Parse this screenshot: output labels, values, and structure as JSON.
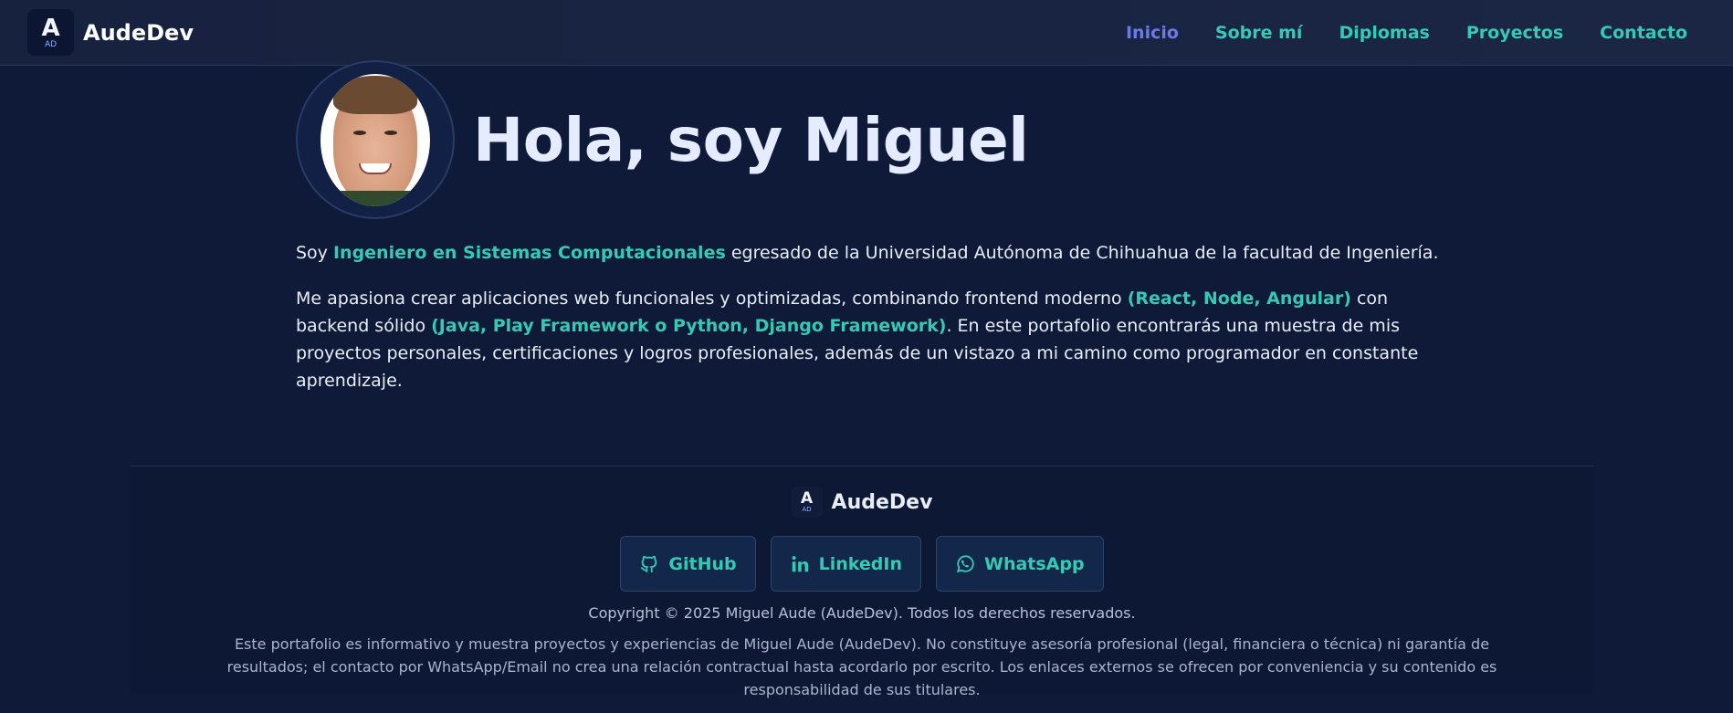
{
  "navbar": {
    "logo": {
      "letter": "A",
      "sub": "AD"
    },
    "brand": "AudeDev",
    "links": [
      {
        "label": "Inicio",
        "active": true
      },
      {
        "label": "Sobre mí",
        "active": false
      },
      {
        "label": "Diplomas",
        "active": false
      },
      {
        "label": "Proyectos",
        "active": false
      },
      {
        "label": "Contacto",
        "active": false
      }
    ]
  },
  "hero": {
    "title": "Hola, soy Miguel",
    "p1": {
      "before": "Soy ",
      "highlight": "Ingeniero en Sistemas Computacionales",
      "after": " egresado de la Universidad Autónoma de Chihuahua de la facultad de Ingeniería."
    },
    "p2": {
      "part1": "Me apasiona crear aplicaciones web funcionales y optimizadas, combinando frontend moderno ",
      "highlight1": "(React, Node, Angular)",
      "part2": " con backend sólido ",
      "highlight2": "(Java, Play Framework o Python, Django Framework)",
      "part3": ". En este portafolio encontrarás una muestra de mis proyectos personales, certificaciones y logros profesionales, además de un vistazo a mi camino como programador en constante aprendizaje."
    }
  },
  "footer": {
    "logo": {
      "letter": "A",
      "sub": "AD"
    },
    "brand": "AudeDev",
    "socials": [
      {
        "label": "GitHub",
        "icon": "github-icon"
      },
      {
        "label": "LinkedIn",
        "icon": "linkedin-icon"
      },
      {
        "label": "WhatsApp",
        "icon": "whatsapp-icon"
      }
    ],
    "copyright": "Copyright © 2025 Miguel Aude (AudeDev). Todos los derechos reservados.",
    "disclaimer": "Este portafolio es informativo y muestra proyectos y experiencias de Miguel Aude (AudeDev). No constituye asesoría profesional (legal, financiera o técnica) ni garantía de resultados; el contacto por WhatsApp/Email no crea una relación contractual hasta acordarlo por escrito. Los enlaces externos se ofrecen por conveniencia y su contenido es responsabilidad de sus titulares."
  },
  "colors": {
    "background": "#0e1a38",
    "accent": "#36c9b4",
    "active_link": "#6b78ee"
  }
}
